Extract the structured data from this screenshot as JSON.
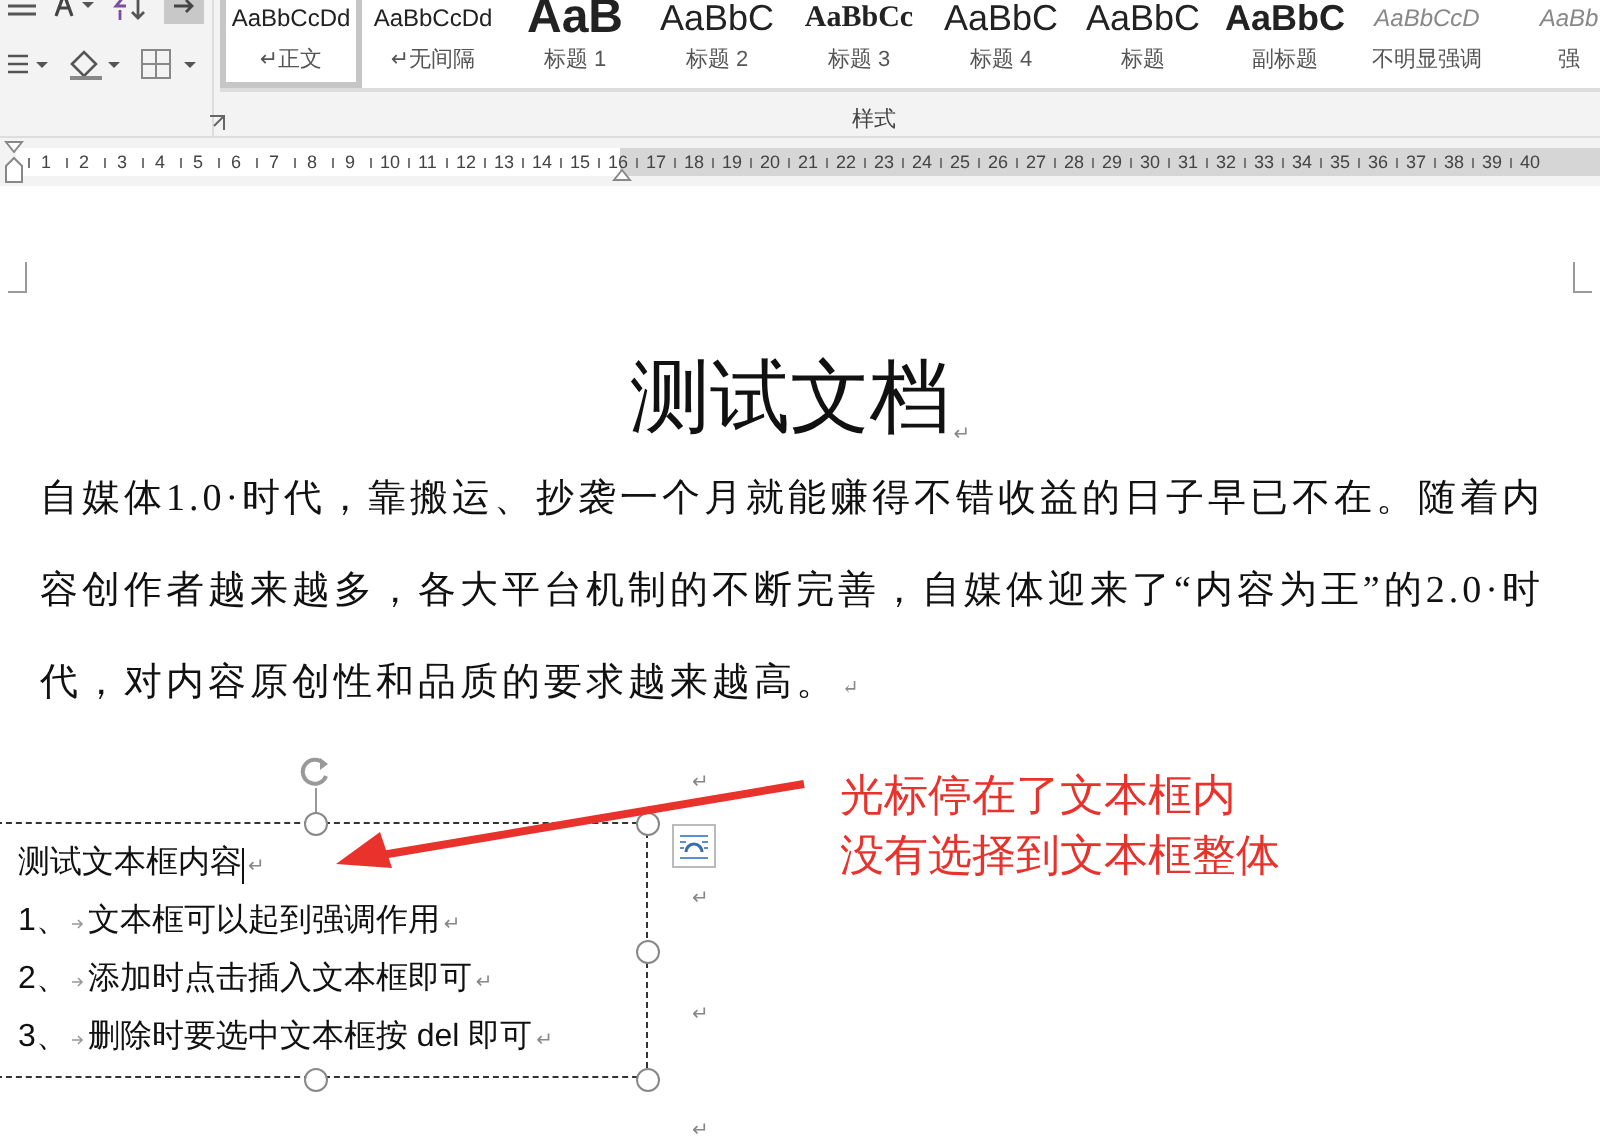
{
  "ribbon": {
    "styles": [
      {
        "sample": "AaBbCcDd",
        "label": "↵正文",
        "kind": "normal",
        "selected": true
      },
      {
        "sample": "AaBbCcDd",
        "label": "↵无间隔",
        "kind": "normal",
        "selected": false
      },
      {
        "sample": "AaB",
        "label": "标题 1",
        "kind": "huge",
        "selected": false
      },
      {
        "sample": "AaBbC",
        "label": "标题 2",
        "kind": "large",
        "selected": false
      },
      {
        "sample": "AaBbCc",
        "label": "标题 3",
        "kind": "serif",
        "selected": false
      },
      {
        "sample": "AaBbC",
        "label": "标题 4",
        "kind": "large",
        "selected": false
      },
      {
        "sample": "AaBbC",
        "label": "标题",
        "kind": "large",
        "selected": false
      },
      {
        "sample": "AaBbC",
        "label": "副标题",
        "kind": "bold",
        "selected": false
      },
      {
        "sample": "AaBbCcD",
        "label": "不明显强调",
        "kind": "italic",
        "selected": false
      },
      {
        "sample": "AaBb",
        "label": "强",
        "kind": "italic",
        "selected": false
      }
    ],
    "group_label": "样式"
  },
  "ruler": {
    "labels": [
      "1",
      "2",
      "3",
      "4",
      "5",
      "6",
      "7",
      "8",
      "9",
      "10",
      "11",
      "12",
      "13",
      "14",
      "15",
      "16",
      "17",
      "18",
      "19",
      "20",
      "21",
      "22",
      "23",
      "24",
      "25",
      "26",
      "27",
      "28",
      "29",
      "30",
      "31",
      "32",
      "33",
      "34",
      "35",
      "36",
      "37",
      "38",
      "39",
      "40"
    ]
  },
  "document": {
    "title": {
      "text": "测试文档",
      "mark": "↵"
    },
    "paragraph": {
      "text": "自媒体1.0·时代，靠搬运、抄袭一个月就能赚得不错收益的日子早已不在。随着内容创作者越来越多，各大平台机制的不断完善，自媒体迎来了“内容为王”的2.0·时代，对内容原创性和品质的要求越来越高。",
      "mark": "↵"
    },
    "side_marks": [
      "↵",
      "↵",
      "↵",
      "↵"
    ],
    "textbox": {
      "lines": [
        {
          "text": "测试文本框内容",
          "mark": "↵",
          "cursor": true
        },
        {
          "number": "1、",
          "text": "文本框可以起到强调作用",
          "mark": "↵",
          "cursor": false
        },
        {
          "number": "2、",
          "text": "添加时点击插入文本框即可",
          "mark": "↵",
          "cursor": false
        },
        {
          "number": "3、",
          "text": "删除时要选中文本框按 del 即可",
          "mark": "↵",
          "cursor": false
        }
      ]
    },
    "annotation": [
      "光标停在了文本框内",
      "没有选择到文本框整体"
    ]
  }
}
